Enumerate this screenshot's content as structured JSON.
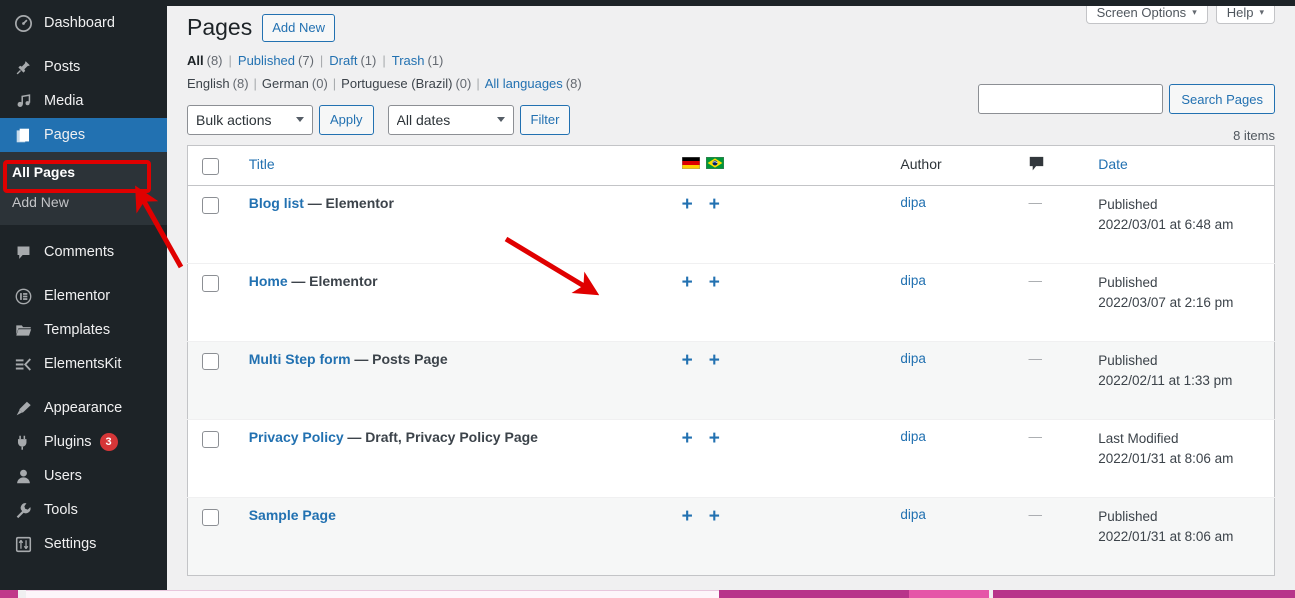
{
  "sidebar": {
    "items": [
      {
        "label": "Dashboard",
        "icon": "dashboard-icon",
        "current": false
      },
      {
        "label": "Posts",
        "icon": "pin-icon",
        "current": false
      },
      {
        "label": "Media",
        "icon": "media-icon",
        "current": false
      },
      {
        "label": "Pages",
        "icon": "page-icon",
        "current": true
      },
      {
        "label": "Comments",
        "icon": "comment-icon",
        "current": false
      },
      {
        "label": "Elementor",
        "icon": "elementor-icon",
        "current": false
      },
      {
        "label": "Templates",
        "icon": "folder-icon",
        "current": false
      },
      {
        "label": "ElementsKit",
        "icon": "elementskit-icon",
        "current": false
      },
      {
        "label": "Appearance",
        "icon": "brush-icon",
        "current": false
      },
      {
        "label": "Plugins",
        "icon": "plug-icon",
        "current": false,
        "badge": "3"
      },
      {
        "label": "Users",
        "icon": "user-icon",
        "current": false
      },
      {
        "label": "Tools",
        "icon": "wrench-icon",
        "current": false
      },
      {
        "label": "Settings",
        "icon": "settings-icon",
        "current": false
      }
    ],
    "submenu": [
      {
        "label": "All Pages",
        "current": true
      },
      {
        "label": "Add New",
        "current": false
      }
    ]
  },
  "screen_meta": {
    "screen_options_label": "Screen Options",
    "help_label": "Help",
    "caret": "▾"
  },
  "header": {
    "title": "Pages",
    "add_new_label": "Add New"
  },
  "status_filters": [
    {
      "label": "All",
      "count": "(8)",
      "current": true
    },
    {
      "label": "Published",
      "count": "(7)",
      "current": false
    },
    {
      "label": "Draft",
      "count": "(1)",
      "current": false
    },
    {
      "label": "Trash",
      "count": "(1)",
      "current": false
    }
  ],
  "language_filters": [
    {
      "label": "English",
      "count": "(8)",
      "current": true
    },
    {
      "label": "German",
      "count": "(0)",
      "current": true
    },
    {
      "label": "Portuguese (Brazil)",
      "count": "(0)",
      "current": true
    },
    {
      "label": "All languages",
      "count": "(8)",
      "current": false
    }
  ],
  "search": {
    "value": "",
    "placeholder": "",
    "submit_label": "Search Pages"
  },
  "tablenav": {
    "bulk_actions_value": "Bulk actions",
    "apply_label": "Apply",
    "dates_value": "All dates",
    "filter_label": "Filter",
    "items_count": "8 items"
  },
  "table": {
    "columns": {
      "title": "Title",
      "author": "Author",
      "comments_icon": "comment-bubble-icon",
      "date": "Date"
    },
    "header_flags": [
      "flag-de",
      "flag-br"
    ],
    "rows": [
      {
        "title": "Blog list",
        "dash": "—",
        "state": "Elementor",
        "plus_icons": [
          "plus-icon-de",
          "plus-icon-br"
        ],
        "author": "dipa",
        "comments": "—",
        "date_status": "Published",
        "date_value": "2022/03/01 at 6:48 am"
      },
      {
        "title": "Home",
        "dash": "—",
        "state": "Elementor",
        "plus_icons": [
          "plus-icon-de",
          "plus-icon-br"
        ],
        "author": "dipa",
        "comments": "—",
        "date_status": "Published",
        "date_value": "2022/03/07 at 2:16 pm"
      },
      {
        "title": "Multi Step form",
        "dash": "—",
        "state": "Posts Page",
        "plus_icons": [
          "plus-icon-de",
          "plus-icon-br"
        ],
        "author": "dipa",
        "comments": "—",
        "date_status": "Published",
        "date_value": "2022/02/11 at 1:33 pm"
      },
      {
        "title": "Privacy Policy",
        "dash": "—",
        "state": "Draft, Privacy Policy Page",
        "plus_icons": [
          "plus-icon-de",
          "plus-icon-br"
        ],
        "author": "dipa",
        "comments": "—",
        "date_status": "Last Modified",
        "date_value": "2022/01/31 at 8:06 am"
      },
      {
        "title": "Sample Page",
        "dash": "",
        "state": "",
        "plus_icons": [
          "plus-icon-de",
          "plus-icon-br"
        ],
        "author": "dipa",
        "comments": "—",
        "date_status": "Published",
        "date_value": "2022/01/31 at 8:06 am"
      }
    ]
  },
  "annotations": {
    "highlight_target": "All Pages",
    "arrow_1_target": "all-pages-submenu-item",
    "arrow_2_target": "home-row-first-plus-icon",
    "color": "#e00000"
  },
  "colors": {
    "sidebar_bg": "#1d2327",
    "submenu_bg": "#2c3338",
    "active_menu_bg": "#2271b1",
    "link_blue": "#2271b1",
    "page_bg": "#f0f0f1",
    "badge_red": "#d63638",
    "annotation_red": "#e00000",
    "taskbar_magenta": "#b8348a"
  }
}
